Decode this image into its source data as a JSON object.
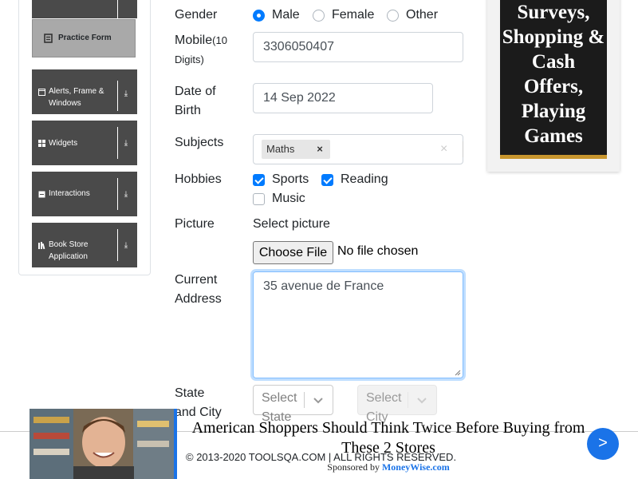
{
  "sidebar": {
    "groups": [
      {
        "label": "Alerts, Frame & Windows",
        "icon": "window-icon"
      },
      {
        "label": "Widgets",
        "icon": "grid-icon"
      },
      {
        "label": "Interactions",
        "icon": "square-icon"
      },
      {
        "label": "Book Store Application",
        "icon": "books-icon"
      }
    ],
    "active_item": {
      "label": "Practice Form",
      "icon": "form-icon"
    }
  },
  "form": {
    "gender": {
      "label": "Gender",
      "options": [
        "Male",
        "Female",
        "Other"
      ],
      "selected": "Male"
    },
    "mobile": {
      "label": "Mobile",
      "hint": "(10 Digits)",
      "value": "3306050407"
    },
    "dob": {
      "label": "Date of",
      "label2": "Birth",
      "value": "14 Sep 2022"
    },
    "subjects": {
      "label": "Subjects",
      "chips": [
        "Maths"
      ],
      "clear": "×",
      "remove": "×"
    },
    "hobbies": {
      "label": "Hobbies",
      "options": [
        {
          "label": "Sports",
          "checked": true
        },
        {
          "label": "Reading",
          "checked": true
        },
        {
          "label": "Music",
          "checked": false
        }
      ]
    },
    "picture": {
      "label": "Picture",
      "select_label": "Select picture",
      "button": "Choose File",
      "status": "No file chosen"
    },
    "address": {
      "label": "Current",
      "label2": "Address",
      "value": "35 avenue de France"
    },
    "state_city": {
      "label": "State",
      "label2": "and City",
      "state_placeholder": "Select State",
      "city_placeholder": "Select City"
    }
  },
  "ad_right": {
    "text": "Surveys, Shopping & Cash Offers, Playing Games"
  },
  "footer": {
    "text": "© 2013-2020 TOOLSQA.COM | ALL RIGHTS RESERVED."
  },
  "ad_bottom": {
    "headline": "American Shoppers Should Think Twice Before Buying from These 2 Stores",
    "sponsor_prefix": "Sponsored by",
    "sponsor_name": "MoneyWise.com",
    "arrow": ">"
  },
  "colors": {
    "accent": "#007bff",
    "sidebar_bg": "#4a4a4a",
    "ad_blue": "#1a73e8"
  }
}
